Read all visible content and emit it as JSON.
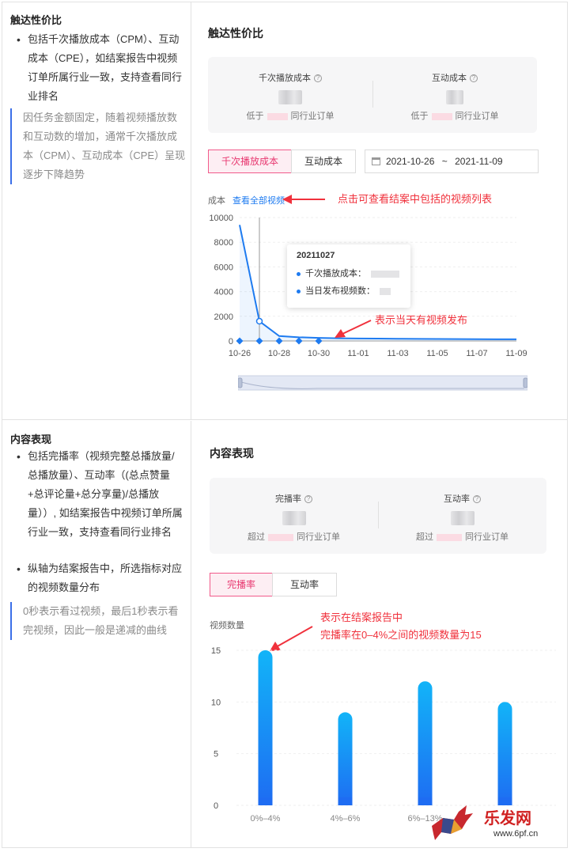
{
  "reach": {
    "left_title": "触达性价比",
    "bullet1": "包括千次播放成本（CPM）、互动成本（CPE），如结案报告中视频订单所属行业一致，支持查看同行业排名",
    "note": "因任务金额固定，随着视频播放数和互动数的增加，通常千次播放成本（CPM）、互动成本（CPE）呈现逐步下降趋势",
    "section_title": "触达性价比",
    "metric1": {
      "label": "千次播放成本",
      "compare_prefix": "低于",
      "compare_suffix": "同行业订单"
    },
    "metric2": {
      "label": "互动成本",
      "compare_prefix": "低于",
      "compare_suffix": "同行业订单"
    },
    "tab_cpm": "千次播放成本",
    "tab_cpe": "互动成本",
    "date_start": "2021-10-26",
    "date_sep": "~",
    "date_end": "2021-11-09",
    "axis_title": "成本",
    "view_all_link": "查看全部视频",
    "annot_list": "点击可查看结案中包括的视频列表",
    "annot_publish": "表示当天有视频发布",
    "tooltip": {
      "date": "20211027",
      "row1": "千次播放成本：",
      "row2": "当日发布视频数："
    }
  },
  "content": {
    "left_title": "内容表现",
    "bullet1": "包括完播率（视频完整总播放量/总播放量）、互动率（(总点赞量+总评论量+总分享量)/总播放量））, 如结案报告中视频订单所属行业一致，支持查看同行业排名",
    "bullet2": "纵轴为结案报告中，所选指标对应的视频数量分布",
    "note": "0秒表示看过视频，最后1秒表示看完视频，因此一般是递减的曲线",
    "section_title": "内容表现",
    "metric1": {
      "label": "完播率",
      "compare_prefix": "超过",
      "compare_suffix": "同行业订单"
    },
    "metric2": {
      "label": "互动率",
      "compare_prefix": "超过",
      "compare_suffix": "同行业订单"
    },
    "tab_completion": "完播率",
    "tab_interaction": "互动率",
    "axis_title": "视频数量",
    "annot_line1": "表示在结案报告中",
    "annot_line2": "完播率在0–4%之间的视频数量为15"
  },
  "watermark": {
    "text": "乐发网",
    "url": "www.6pf.cn"
  },
  "chart_data": [
    {
      "type": "line",
      "title": "",
      "ylabel": "成本",
      "x": [
        "10-26",
        "10-27",
        "10-28",
        "10-29",
        "10-30",
        "10-31",
        "11-01",
        "11-02",
        "11-03",
        "11-04",
        "11-05",
        "11-06",
        "11-07",
        "11-08",
        "11-09"
      ],
      "x_tick_labels": [
        "10-26",
        "10-28",
        "10-30",
        "11-01",
        "11-03",
        "11-05",
        "11-07",
        "11-09"
      ],
      "y_tick_labels": [
        "10000",
        "8000",
        "6000",
        "4000",
        "2000",
        "0"
      ],
      "ylim": [
        0,
        10000
      ],
      "series": [
        {
          "values": [
            9400,
            1600,
            400,
            300,
            250,
            220,
            200,
            190,
            180,
            170,
            160,
            150,
            145,
            140,
            135
          ]
        }
      ],
      "publish_markers_x": [
        "10-26",
        "10-27",
        "10-28",
        "10-29",
        "10-30"
      ],
      "color": "#1e7bf0"
    },
    {
      "type": "bar",
      "title": "",
      "ylabel": "视频数量",
      "categories": [
        "0%–4%",
        "4%–6%",
        "6%–13%",
        ""
      ],
      "values": [
        15,
        9,
        12,
        10
      ],
      "y_tick_labels": [
        "15",
        "10",
        "5",
        "0"
      ],
      "ylim": [
        0,
        15
      ],
      "color": "#1e8ff5"
    }
  ]
}
